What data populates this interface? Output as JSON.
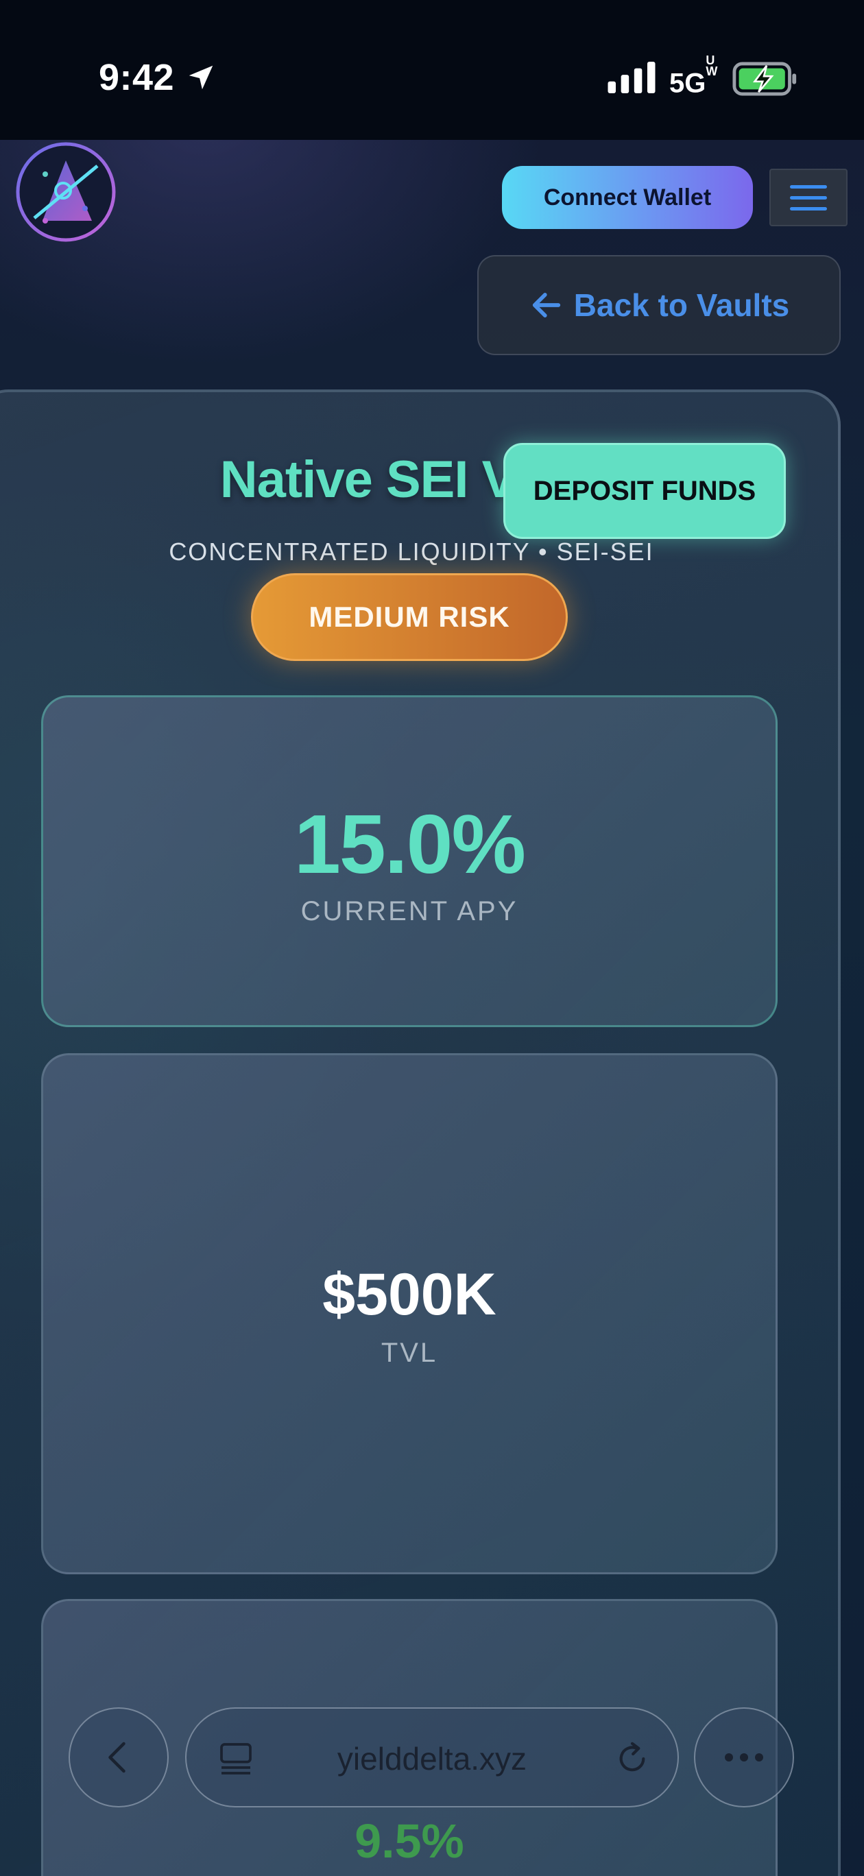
{
  "status_bar": {
    "time": "9:42",
    "network": "5G",
    "network_suffix_top": "U",
    "network_suffix_bottom": "W",
    "location_icon": "location-arrow-icon",
    "signal_icon": "signal-bars-icon",
    "battery_icon": "battery-charging-icon"
  },
  "header": {
    "logo_icon": "yielddelta-logo-icon",
    "connect_wallet_label": "Connect Wallet",
    "menu_icon": "hamburger-menu-icon",
    "back_label": "Back to Vaults",
    "back_icon": "arrow-left-icon"
  },
  "vault": {
    "title": "Native SEI Vault",
    "deposit_label": "DEPOSIT FUNDS",
    "subtitle": "CONCENTRATED LIQUIDITY • SEI-SEI",
    "risk_label": "MEDIUM RISK",
    "apy_value": "15.0%",
    "apy_label": "CURRENT APY",
    "tvl_value": "$500K",
    "tvl_label": "TVL",
    "third_value": "9.5%"
  },
  "browser": {
    "url": "yielddelta.xyz",
    "back_icon": "chevron-left-icon",
    "tabs_icon": "tabs-icon",
    "reload_icon": "reload-icon",
    "more_icon": "more-dots-icon"
  },
  "colors": {
    "accent_teal": "#62dfc3",
    "link_blue": "#4a8fe8",
    "risk_orange": "#e59a36",
    "positive_green": "#3e9a4e"
  }
}
